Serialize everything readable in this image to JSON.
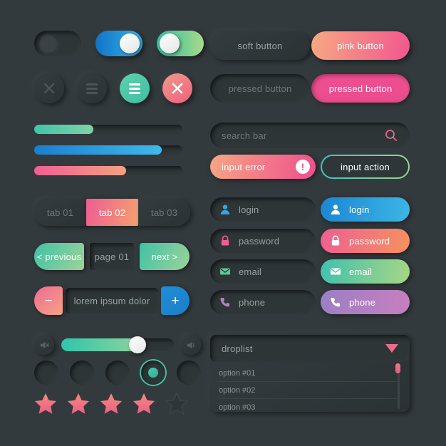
{
  "background_color": "#333a3d",
  "toggles": [
    {
      "name": "toggle-off",
      "state": "off",
      "color": "#3a4245"
    },
    {
      "name": "toggle-blue-on",
      "state": "on",
      "color": "#1273c8"
    },
    {
      "name": "toggle-green-on",
      "state": "on",
      "color": "#2fbfa0"
    }
  ],
  "icon_buttons": [
    {
      "name": "close-icon",
      "style": "dark",
      "glyph": "✕"
    },
    {
      "name": "menu-icon",
      "style": "dark",
      "glyph": "☰"
    },
    {
      "name": "menu-icon",
      "style": "teal",
      "glyph": "☰",
      "color": "#3fbfa2"
    },
    {
      "name": "close-icon",
      "style": "pink",
      "glyph": "✕",
      "color": "#ef5f7e"
    }
  ],
  "progress_bars": [
    {
      "name": "progress-green",
      "value": 40,
      "color": "#3fc6a8"
    },
    {
      "name": "progress-blue",
      "value": 86,
      "color": "#1b7fd0"
    },
    {
      "name": "progress-pink",
      "value": 62,
      "color": "#ef5f93"
    }
  ],
  "tabs": [
    {
      "label": "tab 01",
      "active": false
    },
    {
      "label": "tab 02",
      "active": true
    },
    {
      "label": "tab 03",
      "active": false
    }
  ],
  "pagination": {
    "previous_label": "< previous",
    "page_label": "page 01",
    "next_label": "next >"
  },
  "stepper": {
    "minus_label": "−",
    "value": "lorem ipsum dolor",
    "plus_label": "+"
  },
  "volume_slider": {
    "value": 70,
    "mute_icon": "speaker-mute-icon",
    "volume_icon": "speaker-icon"
  },
  "radios": [
    {
      "selected": false
    },
    {
      "selected": false
    },
    {
      "selected": false
    },
    {
      "selected": true
    },
    {
      "selected": false
    }
  ],
  "rating": {
    "filled": 4,
    "total": 5,
    "star_color": "#ef6b8b"
  },
  "buttons": {
    "soft_label": "soft button",
    "pink_label": "pink button",
    "pressed_soft_label": "pressed button",
    "pressed_pink_label": "pressed button"
  },
  "search": {
    "placeholder": "search bar",
    "icon": "search-icon",
    "icon_color": "#e06b8c"
  },
  "inputs": {
    "error_label": "input error",
    "error_badge": "!",
    "action_label": "input action"
  },
  "fields": [
    {
      "label": "login",
      "icon": "user-icon",
      "icon_color": "#3ba3d8",
      "accent": "#1b86d2"
    },
    {
      "label": "password",
      "icon": "lock-icon",
      "icon_color": "#ef5f93",
      "accent": "#ef5f93"
    },
    {
      "label": "email",
      "icon": "envelope-icon",
      "icon_color": "#5cc79a",
      "accent": "#3fc2ae"
    },
    {
      "label": "phone",
      "icon": "phone-icon",
      "icon_color": "#b77fc4",
      "accent": "#9b7fc4"
    }
  ],
  "droplist": {
    "label": "droplist",
    "arrow_icon": "chevron-down-icon",
    "arrow_color": "#ef6b8b",
    "options": [
      "option #01",
      "option #02",
      "option #03"
    ]
  }
}
